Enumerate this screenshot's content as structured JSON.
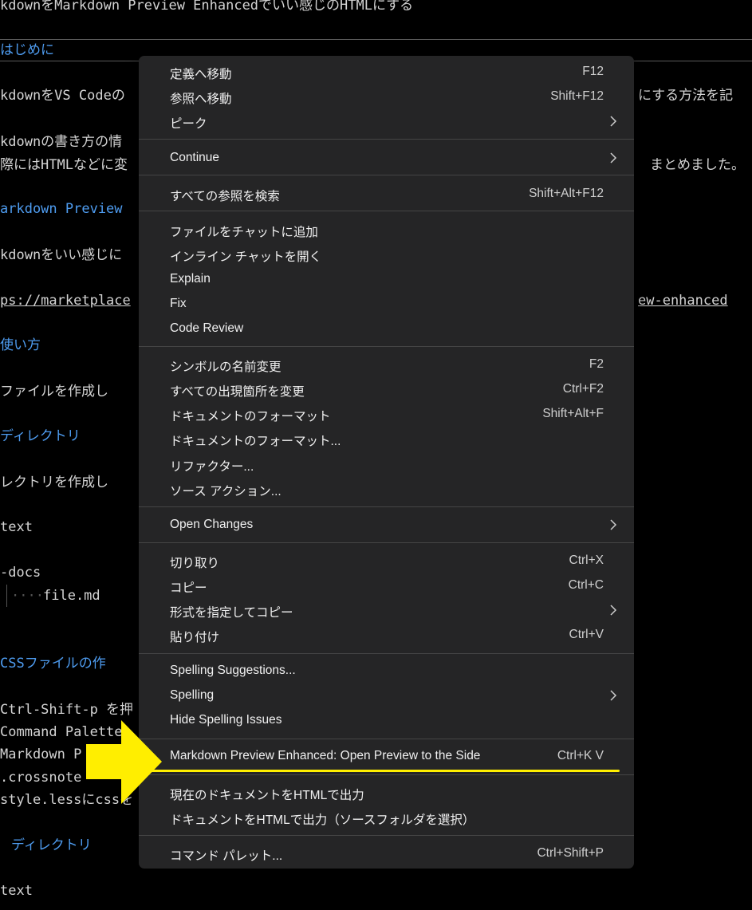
{
  "editor": {
    "line_title": "kdownをMarkdown Preview Enhancedでいい感じのHTMLにする",
    "h_intro": "はじめに",
    "line1a": "kdownをVS Codeの",
    "line1b": "にする方法を記",
    "line2": "kdownの書き方の情",
    "line3a": "際にはHTMLなどに変",
    "line3b": "まとめました。",
    "h_mpe": "arkdown Preview",
    "line4": "kdownをいい感じに",
    "link_a": "ps://marketplace",
    "link_b": "ew-enhanced",
    "h_usage": "使い方",
    "line5": "ファイルを作成し",
    "h_dir": "ディレクトリ",
    "line6": "レクトリを作成し",
    "code1": "text",
    "code2": "-docs",
    "code3": "file.md",
    "h_css": "CSSファイルの作",
    "line7": "Ctrl-Shift-p を押",
    "line8": "Command Palette",
    "line9": "Markdown P",
    "line10": ".crossnote",
    "line11": "style.lessにcssを",
    "h_dir2": "ディレクトリ",
    "code4": "text"
  },
  "context_menu": {
    "items": [
      {
        "label": "定義へ移動",
        "shortcut": "F12"
      },
      {
        "label": "参照へ移動",
        "shortcut": "Shift+F12"
      },
      {
        "label": "ピーク",
        "submenu": true
      },
      {
        "label": "Continue",
        "submenu": true
      },
      {
        "label": "すべての参照を検索",
        "shortcut": "Shift+Alt+F12"
      },
      {
        "label": "ファイルをチャットに追加"
      },
      {
        "label": "インライン チャットを開く"
      },
      {
        "label": "Explain"
      },
      {
        "label": "Fix"
      },
      {
        "label": "Code Review"
      },
      {
        "label": "シンボルの名前変更",
        "shortcut": "F2"
      },
      {
        "label": "すべての出現箇所を変更",
        "shortcut": "Ctrl+F2"
      },
      {
        "label": "ドキュメントのフォーマット",
        "shortcut": "Shift+Alt+F"
      },
      {
        "label": "ドキュメントのフォーマット..."
      },
      {
        "label": "リファクター..."
      },
      {
        "label": "ソース アクション..."
      },
      {
        "label": "Open Changes",
        "submenu": true
      },
      {
        "label": "切り取り",
        "shortcut": "Ctrl+X"
      },
      {
        "label": "コピー",
        "shortcut": "Ctrl+C"
      },
      {
        "label": "形式を指定してコピー",
        "submenu": true
      },
      {
        "label": "貼り付け",
        "shortcut": "Ctrl+V"
      },
      {
        "label": "Spelling Suggestions..."
      },
      {
        "label": "Spelling",
        "submenu": true
      },
      {
        "label": "Hide Spelling Issues"
      },
      {
        "label": "Markdown Preview Enhanced: Open Preview to the Side",
        "shortcut": "Ctrl+K V"
      },
      {
        "label": "現在のドキュメントをHTMLで出力"
      },
      {
        "label": "ドキュメントをHTMLで出力（ソースフォルダを選択）"
      },
      {
        "label": "コマンド パレット...",
        "shortcut": "Ctrl+Shift+P"
      }
    ]
  },
  "annotation": {
    "arrow_color": "#ffee00",
    "underline_color": "#ffee00"
  },
  "colors": {
    "menu_bg": "#252526",
    "heading": "#4e9cf0",
    "background": "#000000"
  }
}
